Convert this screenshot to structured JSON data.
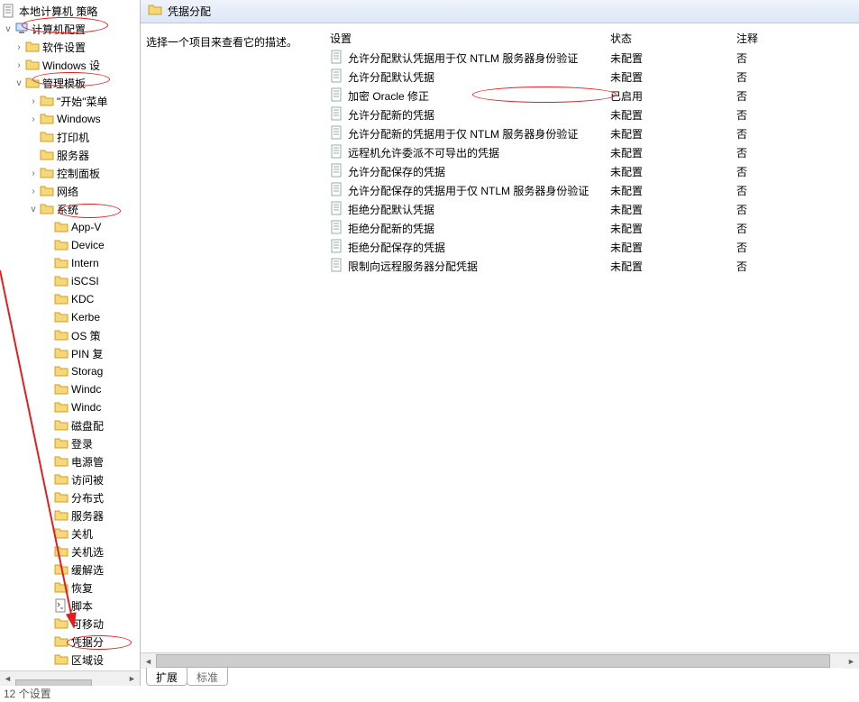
{
  "sidebar": {
    "root_label": "本地计算机 策略",
    "computer_config": "计算机配置",
    "items_l2": [
      {
        "label": "软件设置",
        "expander": ">"
      },
      {
        "label": "Windows 设",
        "expander": ">"
      },
      {
        "label": "管理模板",
        "expander": "v"
      }
    ],
    "admin_children": [
      {
        "label": "\"开始\"菜单",
        "expander": ">"
      },
      {
        "label": "Windows",
        "expander": ">"
      },
      {
        "label": "打印机",
        "expander": ""
      },
      {
        "label": "服务器",
        "expander": ""
      },
      {
        "label": "控制面板",
        "expander": ">"
      },
      {
        "label": "网络",
        "expander": ">"
      },
      {
        "label": "系统",
        "expander": "v"
      }
    ],
    "system_children": [
      "App-V",
      "Device",
      "Intern",
      "iSCSI",
      "KDC",
      "Kerbe",
      "OS 策",
      "PIN 复",
      "Storag",
      "Windc",
      "Windc",
      "磁盘配",
      "登录",
      "电源管",
      "访问被",
      "分布式",
      "服务器",
      "关机",
      "关机选",
      "缓解选",
      "恢复",
      "脚本",
      "可移动",
      "凭据分",
      "区域设"
    ]
  },
  "header": {
    "title": "凭据分配"
  },
  "desc": {
    "text": "选择一个项目来查看它的描述。"
  },
  "columns": {
    "setting": "设置",
    "state": "状态",
    "note": "注释"
  },
  "rows": [
    {
      "label": "允许分配默认凭据用于仅 NTLM 服务器身份验证",
      "state": "未配置",
      "note": "否"
    },
    {
      "label": "允许分配默认凭据",
      "state": "未配置",
      "note": "否"
    },
    {
      "label": "加密 Oracle 修正",
      "state": "已启用",
      "note": "否"
    },
    {
      "label": "允许分配新的凭据",
      "state": "未配置",
      "note": "否"
    },
    {
      "label": "允许分配新的凭据用于仅 NTLM 服务器身份验证",
      "state": "未配置",
      "note": "否"
    },
    {
      "label": "远程机允许委派不可导出的凭据",
      "state": "未配置",
      "note": "否"
    },
    {
      "label": "允许分配保存的凭据",
      "state": "未配置",
      "note": "否"
    },
    {
      "label": "允许分配保存的凭据用于仅 NTLM 服务器身份验证",
      "state": "未配置",
      "note": "否"
    },
    {
      "label": "拒绝分配默认凭据",
      "state": "未配置",
      "note": "否"
    },
    {
      "label": "拒绝分配新的凭据",
      "state": "未配置",
      "note": "否"
    },
    {
      "label": "拒绝分配保存的凭据",
      "state": "未配置",
      "note": "否"
    },
    {
      "label": "限制向远程服务器分配凭据",
      "state": "未配置",
      "note": "否"
    }
  ],
  "tabs": {
    "extended": "扩展",
    "standard": "标准"
  },
  "status": "12 个设置"
}
